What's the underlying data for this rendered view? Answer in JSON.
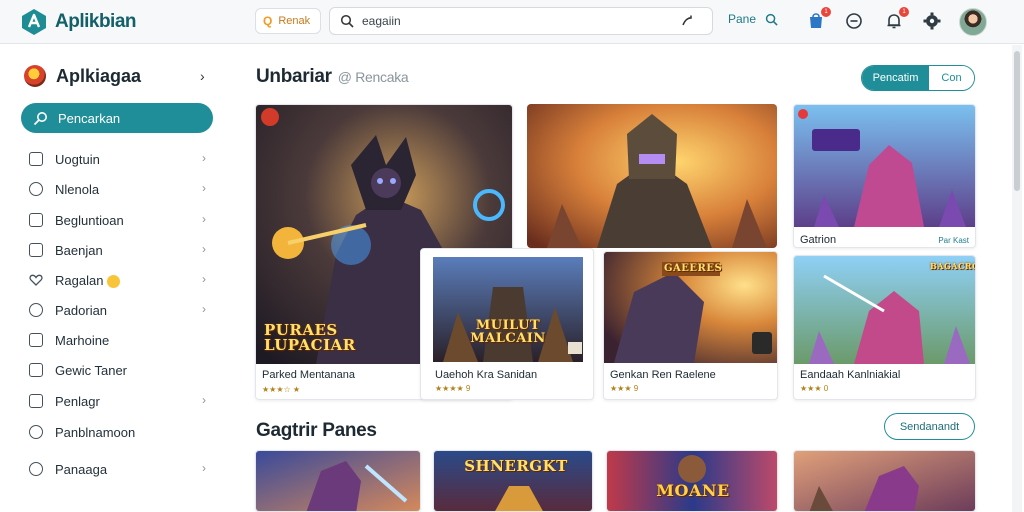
{
  "header": {
    "app_name": "Aplikbian",
    "filter_chip": "Renak",
    "search_value": "eagaiin",
    "action_label": "Pane",
    "cart_badge": "1",
    "bell_badge": "1"
  },
  "sidebar": {
    "title": "Aplkiagaa",
    "active_item": "Pencarkan",
    "items": [
      {
        "label": "Uogtuin",
        "icon": "calendar-icon"
      },
      {
        "label": "Nlenola",
        "icon": "user-icon"
      },
      {
        "label": "Begluntioan",
        "icon": "tag-icon"
      },
      {
        "label": "Baenjan",
        "icon": "store-icon"
      },
      {
        "label": "Ragalan",
        "icon": "heart-icon"
      },
      {
        "label": "Padorian",
        "icon": "chat-icon"
      },
      {
        "label": "Marhoine",
        "icon": "image-icon"
      },
      {
        "label": "Gewic Taner",
        "icon": "window-icon"
      },
      {
        "label": "Penlagr",
        "icon": "bookmark-icon"
      },
      {
        "label": "Panblnamoon",
        "icon": "person-icon"
      },
      {
        "label": "Panaaga",
        "icon": "puzzle-icon"
      }
    ]
  },
  "main": {
    "section1": {
      "title": "Unbariar",
      "subtitle": "@ Rencaka"
    },
    "toggle": {
      "left": "Pencatim",
      "right": "Con"
    },
    "section2": {
      "title": "Gagtrir Panes",
      "button": "Sendanandt"
    },
    "cards": [
      {
        "caption": "Parked Mentanana",
        "rating": "★★★☆ ★",
        "art_title": "PURAES LUPACIAR"
      },
      {
        "caption": "Gatrion",
        "tag": "Par Kast"
      },
      {
        "caption": "Uaehoh Kra Sanidan",
        "rating": "★★★★ 9",
        "art_title": "MUILUT MALCAIN"
      },
      {
        "caption": "Genkan Ren Raelene",
        "rating": "★★★ 9",
        "art_title": "GAEERES"
      },
      {
        "caption": "Eandaah Kanlniakial",
        "rating": "★★★ 0",
        "art_title": "BAGACRO"
      }
    ],
    "row2": [
      {
        "art_title": ""
      },
      {
        "art_title": "SHNERGKT"
      },
      {
        "art_title": "MOANE"
      },
      {
        "art_title": ""
      }
    ]
  }
}
